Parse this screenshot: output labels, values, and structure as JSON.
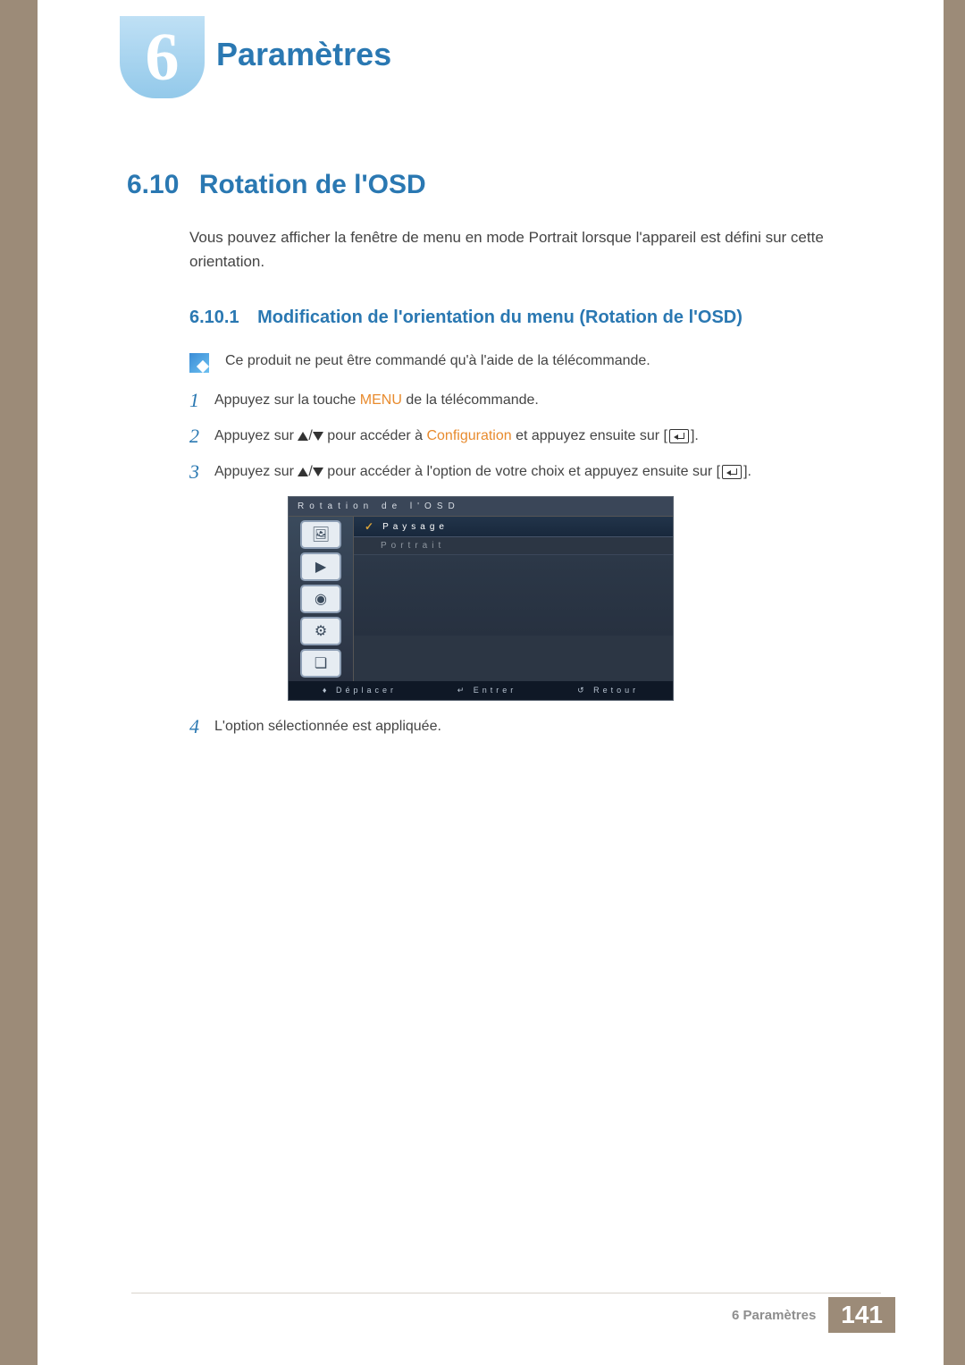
{
  "chapter": {
    "number": "6",
    "title": "Paramètres"
  },
  "section": {
    "number": "6.10",
    "title": "Rotation de l'OSD"
  },
  "intro": "Vous pouvez afficher la fenêtre de menu en mode Portrait lorsque l'appareil est défini sur cette orientation.",
  "subsection": {
    "number": "6.10.1",
    "title": "Modification de l'orientation du menu (Rotation de l'OSD)"
  },
  "note": "Ce produit ne peut être commandé qu'à l'aide de la télécommande.",
  "steps": {
    "s1": {
      "n": "1",
      "before": "Appuyez sur la touche ",
      "menu": "MENU",
      "after": " de la télécommande."
    },
    "s2": {
      "n": "2",
      "before": "Appuyez sur ",
      "mid": " pour accéder à ",
      "config": "Configuration",
      "after": " et appuyez ensuite sur [",
      "close": "]."
    },
    "s3": {
      "n": "3",
      "before": "Appuyez sur ",
      "mid": " pour accéder à l'option de votre choix et appuyez ensuite sur [",
      "close": "]."
    },
    "s4": {
      "n": "4",
      "text": "L'option sélectionnée est appliquée."
    }
  },
  "osd": {
    "title": "Rotation de l'OSD",
    "items": {
      "sel": "Paysage",
      "alt": "Portrait"
    },
    "footer": {
      "move": "Déplacer",
      "enter": "Entrer",
      "back": "Retour"
    }
  },
  "footer": {
    "label": "6 Paramètres",
    "page": "141"
  }
}
